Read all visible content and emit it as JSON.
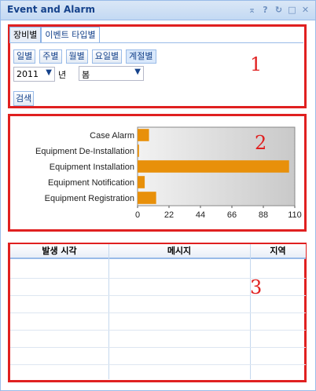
{
  "window": {
    "title": "Event and Alarm"
  },
  "tools": [
    "collapse-icon",
    "help-icon",
    "refresh-icon",
    "maximize-icon",
    "close-icon"
  ],
  "section1": {
    "tabs": [
      {
        "label": "장비별",
        "active": false
      },
      {
        "label": "이벤트 타입별",
        "active": true
      }
    ],
    "period_buttons": [
      "일별",
      "주별",
      "월별",
      "요일별",
      "계절별"
    ],
    "year_value": "2011",
    "year_label": "년",
    "season_value": "봄",
    "search_label": "검색",
    "number": "1"
  },
  "section2": {
    "number": "2"
  },
  "chart_data": {
    "type": "bar",
    "orientation": "horizontal",
    "categories": [
      "Case Alarm",
      "Equipment De-Installation",
      "Equipment Installation",
      "Equipment Notification",
      "Equipment Registration"
    ],
    "values": [
      8,
      1,
      106,
      5,
      13
    ],
    "xticks": [
      0,
      22,
      44,
      66,
      88,
      110
    ],
    "xlim": [
      0,
      110
    ],
    "bar_color": "#e8900a"
  },
  "section3": {
    "columns": [
      "발생 시각",
      "메시지",
      "지역"
    ],
    "number": "3"
  }
}
